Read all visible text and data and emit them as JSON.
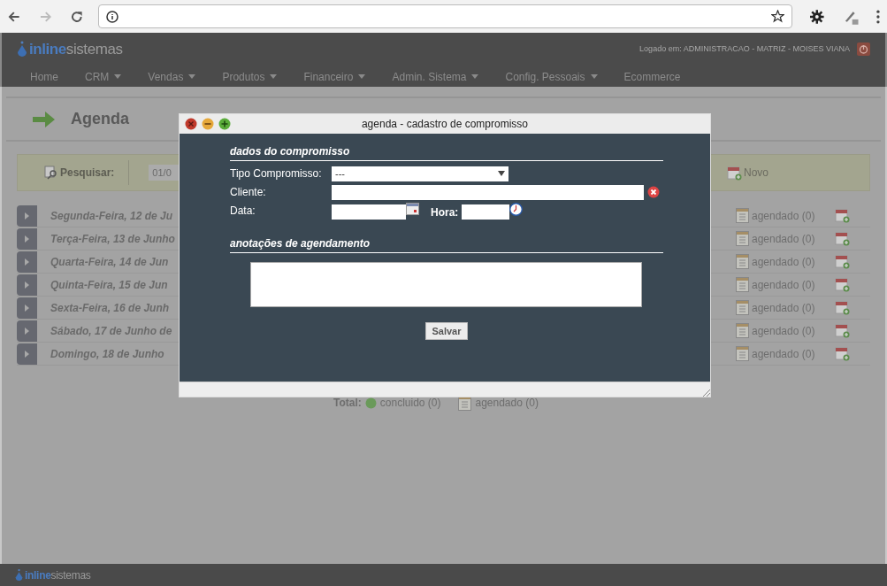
{
  "header": {
    "logo": {
      "part_a": "inline",
      "part_b": "sistemas"
    },
    "logged_in": "Logado em: ADMINISTRACAO - MATRIZ - MOISES VIANA",
    "nav": [
      {
        "label": "Home",
        "dropdown": false
      },
      {
        "label": "CRM",
        "dropdown": true
      },
      {
        "label": "Vendas",
        "dropdown": true
      },
      {
        "label": "Produtos",
        "dropdown": true
      },
      {
        "label": "Financeiro",
        "dropdown": true
      },
      {
        "label": "Admin. Sistema",
        "dropdown": true
      },
      {
        "label": "Config. Pessoais",
        "dropdown": true
      },
      {
        "label": "Ecommerce",
        "dropdown": false
      }
    ]
  },
  "page": {
    "title": "Agenda",
    "search_label": "Pesquisar:",
    "search_value": "01/0",
    "new_button": "Novo",
    "days": [
      {
        "label": "Segunda-Feira, 12 de Ju",
        "status": "agendado (0)"
      },
      {
        "label": "Terça-Feira, 13 de Junho",
        "status": "agendado (0)"
      },
      {
        "label": "Quarta-Feira, 14 de Jun",
        "status": "agendado (0)"
      },
      {
        "label": "Quinta-Feira, 15 de Jun",
        "status": "agendado (0)"
      },
      {
        "label": "Sexta-Feira, 16 de Junh",
        "status": "agendado (0)"
      },
      {
        "label": "Sábado, 17 de Junho de",
        "status": "agendado (0)"
      },
      {
        "label": "Domingo, 18 de Junho",
        "status": "agendado (0)"
      }
    ],
    "totals": {
      "label": "Total:",
      "done": "concluido (0)",
      "scheduled": "agendado (0)"
    }
  },
  "modal": {
    "title": "agenda - cadastro de compromisso",
    "section_1": "dados do compromisso",
    "type_label": "Tipo Compromisso:",
    "type_value": "---",
    "client_label": "Cliente:",
    "date_label": "Data:",
    "time_label": "Hora:",
    "section_2": "anotações de agendamento",
    "save": "Salvar"
  },
  "footer": {
    "logo": {
      "part_a": "inline",
      "part_b": "sistemas"
    }
  }
}
